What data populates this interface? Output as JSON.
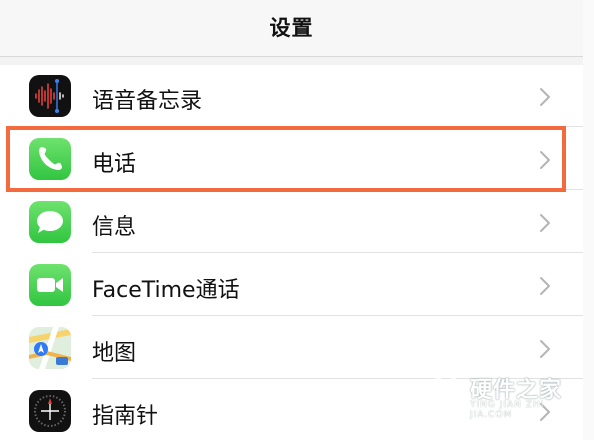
{
  "header": {
    "title": "设置"
  },
  "items": [
    {
      "label": "语音备忘录",
      "icon": "voice-memos-icon"
    },
    {
      "label": "电话",
      "icon": "phone-icon"
    },
    {
      "label": "信息",
      "icon": "messages-icon"
    },
    {
      "label": "FaceTime通话",
      "icon": "facetime-icon"
    },
    {
      "label": "地图",
      "icon": "maps-icon"
    },
    {
      "label": "指南针",
      "icon": "compass-icon"
    }
  ],
  "highlight_color": "#f26a3d",
  "watermark": {
    "title": "硬件之家",
    "subtitle": "YING JIAN ZHI JIA.COM"
  }
}
